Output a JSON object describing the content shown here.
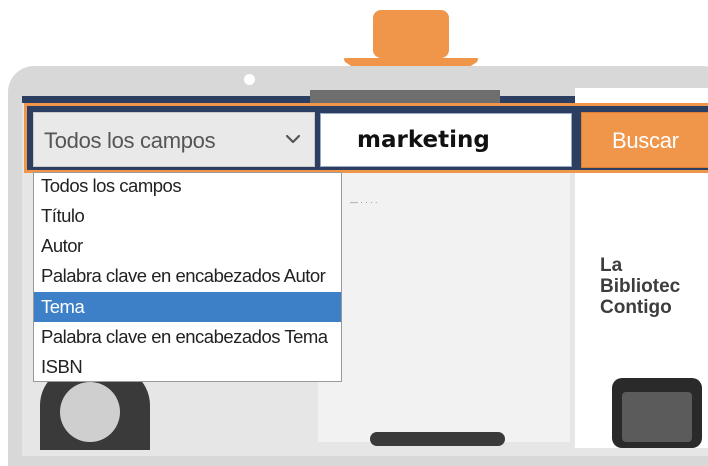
{
  "search": {
    "field_selected": "Todos los campos",
    "query": "marketing",
    "button_label": "Buscar",
    "options": [
      "Todos los campos",
      "Título",
      "Autor",
      "Palabra clave en encabezados Autor",
      "Tema",
      "Palabra clave en encabezados Tema",
      "ISBN"
    ],
    "highlighted_option": "Tema"
  },
  "background_page": {
    "heading": "La\nBibliotec\nContigo"
  },
  "colors": {
    "accent_orange": "#f0964b",
    "navy": "#2d3e63",
    "selected_blue": "#3d80c8"
  }
}
